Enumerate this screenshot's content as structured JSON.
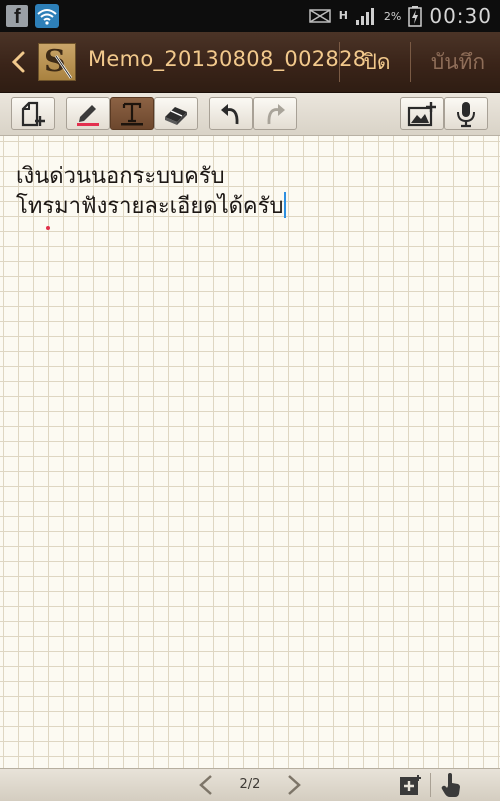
{
  "status_bar": {
    "time": "00:30",
    "battery": "2%",
    "network": "H",
    "icons": [
      "facebook-icon",
      "wifi-icon",
      "signal-icon",
      "battery-icon"
    ]
  },
  "title_bar": {
    "app_logo_letter": "S",
    "title": "Memo_20130808_002828",
    "close_label": "ปิด",
    "save_label": "บันทึก"
  },
  "toolbar": {
    "tools": [
      "new-page-icon",
      "pen-icon",
      "text-icon",
      "eraser-icon",
      "undo-icon",
      "redo-icon",
      "insert-image-icon",
      "microphone-icon"
    ],
    "active_tool": "text-icon",
    "pen_color": "#e3304f"
  },
  "note": {
    "lines": [
      "เงินด่วนนอกระบบครับ",
      "โทรมาฟังรายละเอียดได้ครับ"
    ]
  },
  "bottom_bar": {
    "page_indicator": "2/2"
  },
  "colors": {
    "title_text": "#f2c98c",
    "title_bg": "#3a2419",
    "paper": "#fcfaf2",
    "grid": "#ded6c2",
    "active_tool_bg": "#7a5235"
  }
}
